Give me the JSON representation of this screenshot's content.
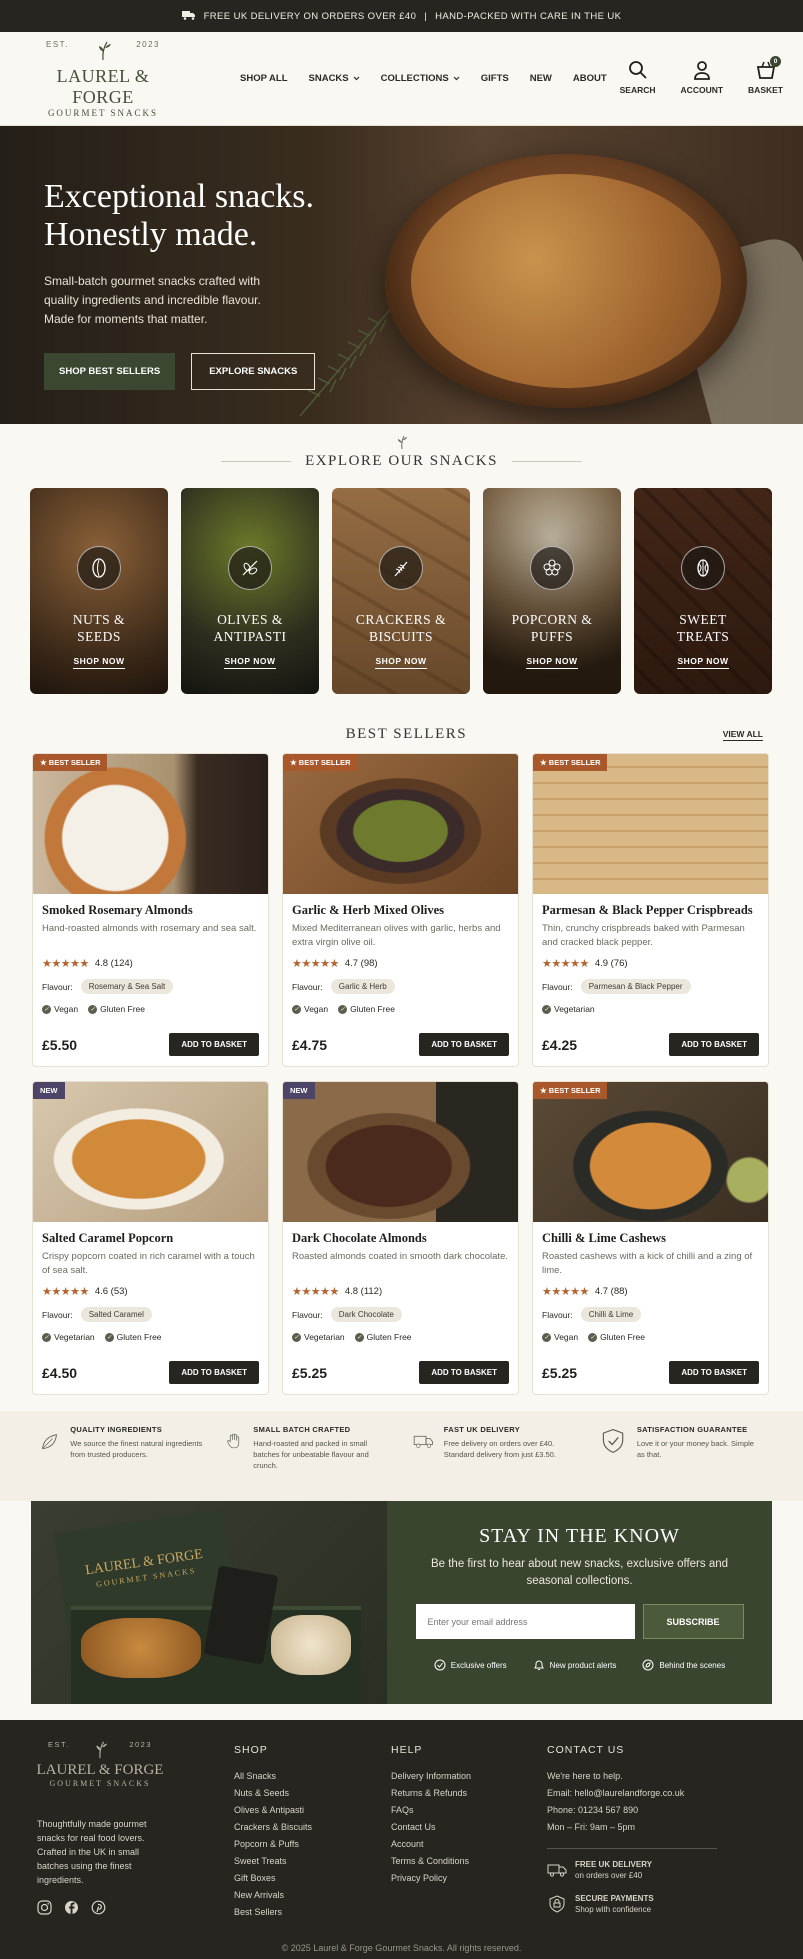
{
  "topbar": {
    "text1": "FREE UK DELIVERY ON ORDERS OVER £40",
    "sep": "|",
    "text2": "HAND-PACKED WITH CARE IN THE UK"
  },
  "logo": {
    "est": "EST.",
    "year": "2023",
    "name": "LAUREL & FORGE",
    "sub": "GOURMET SNACKS"
  },
  "nav": [
    "SHOP ALL",
    "SNACKS",
    "COLLECTIONS",
    "GIFTS",
    "NEW",
    "ABOUT"
  ],
  "header_icons": {
    "search": "SEARCH",
    "account": "ACCOUNT",
    "basket": "BASKET",
    "basket_count": "0"
  },
  "hero": {
    "line1": "Exceptional snacks.",
    "line2": "Honestly made.",
    "desc": "Small-batch gourmet snacks crafted with quality ingredients and incredible flavour. Made for moments that matter.",
    "btn1": "SHOP BEST SELLERS",
    "btn2": "EXPLORE SNACKS"
  },
  "explore": {
    "title": "EXPLORE OUR SNACKS",
    "categories": [
      {
        "l1": "NUTS &",
        "l2": "SEEDS",
        "shop": "SHOP NOW"
      },
      {
        "l1": "OLIVES &",
        "l2": "ANTIPASTI",
        "shop": "SHOP NOW"
      },
      {
        "l1": "CRACKERS &",
        "l2": "BISCUITS",
        "shop": "SHOP NOW"
      },
      {
        "l1": "POPCORN &",
        "l2": "PUFFS",
        "shop": "SHOP NOW"
      },
      {
        "l1": "SWEET",
        "l2": "TREATS",
        "shop": "SHOP NOW"
      }
    ]
  },
  "bestsellers": {
    "title": "BEST SELLERS",
    "view_all": "VIEW ALL",
    "flavour_label": "Flavour:",
    "add_label": "ADD TO BASKET",
    "products": [
      {
        "tag": "★ BEST SELLER",
        "name": "Smoked Rosemary Almonds",
        "desc": "Hand-roasted almonds with rosemary and sea salt.",
        "rating": "4.8 (124)",
        "flavour": "Rosemary & Sea Salt",
        "diet": [
          "Vegan",
          "Gluten Free"
        ],
        "price": "£5.50"
      },
      {
        "tag": "★ BEST SELLER",
        "name": "Garlic & Herb Mixed Olives",
        "desc": "Mixed Mediterranean olives with garlic, herbs and extra virgin olive oil.",
        "rating": "4.7 (98)",
        "flavour": "Garlic & Herb",
        "diet": [
          "Vegan",
          "Gluten Free"
        ],
        "price": "£4.75"
      },
      {
        "tag": "★ BEST SELLER",
        "name": "Parmesan & Black Pepper Crispbreads",
        "desc": "Thin, crunchy crispbreads baked with Parmesan and cracked black pepper.",
        "rating": "4.9 (76)",
        "flavour": "Parmesan & Black Pepper",
        "diet": [
          "Vegetarian"
        ],
        "price": "£4.25"
      },
      {
        "tag": "NEW",
        "name": "Salted Caramel Popcorn",
        "desc": "Crispy popcorn coated in rich caramel with a touch of sea salt.",
        "rating": "4.6 (53)",
        "flavour": "Salted Caramel",
        "diet": [
          "Vegetarian",
          "Gluten Free"
        ],
        "price": "£4.50"
      },
      {
        "tag": "NEW",
        "name": "Dark Chocolate Almonds",
        "desc": "Roasted almonds coated in smooth dark chocolate.",
        "rating": "4.8 (112)",
        "flavour": "Dark Chocolate",
        "diet": [
          "Vegetarian",
          "Gluten Free"
        ],
        "price": "£5.25"
      },
      {
        "tag": "★ BEST SELLER",
        "name": "Chilli & Lime Cashews",
        "desc": "Roasted cashews with a kick of chilli and a zing of lime.",
        "rating": "4.7 (88)",
        "flavour": "Chilli & Lime",
        "diet": [
          "Vegan",
          "Gluten Free"
        ],
        "price": "£5.25"
      }
    ]
  },
  "features": [
    {
      "title": "QUALITY INGREDIENTS",
      "text": "We source the finest natural ingredients from trusted producers."
    },
    {
      "title": "SMALL BATCH CRAFTED",
      "text": "Hand-roasted and packed in small batches for unbeatable flavour and crunch."
    },
    {
      "title": "FAST UK DELIVERY",
      "text": "Free delivery on orders over £40. Standard delivery from just £3.50."
    },
    {
      "title": "SATISFACTION GUARANTEE",
      "text": "Love it or your money back. Simple as that."
    }
  ],
  "newsletter": {
    "title": "STAY IN THE KNOW",
    "desc": "Be the first to hear about new snacks, exclusive offers and seasonal collections.",
    "placeholder": "Enter your email address",
    "button": "SUBSCRIBE",
    "perks": [
      "Exclusive offers",
      "New product alerts",
      "Behind the scenes"
    ],
    "box_brand": "LAUREL & FORGE",
    "box_sub": "GOURMET SNACKS"
  },
  "footer": {
    "about": "Thoughtfully made gourmet snacks for real food lovers. Crafted in the UK in small batches using the finest ingredients.",
    "shop_title": "SHOP",
    "shop": [
      "All Snacks",
      "Nuts & Seeds",
      "Olives & Antipasti",
      "Crackers & Biscuits",
      "Popcorn & Puffs",
      "Sweet Treats",
      "Gift Boxes",
      "New Arrivals",
      "Best Sellers"
    ],
    "help_title": "HELP",
    "help": [
      "Delivery Information",
      "Returns & Refunds",
      "FAQs",
      "Contact Us",
      "Account",
      "Terms & Conditions",
      "Privacy Policy"
    ],
    "contact_title": "CONTACT US",
    "contact": [
      "We're here to help.",
      "Email: hello@laurelandforge.co.uk",
      "Phone: 01234 567 890",
      "Mon – Fri: 9am – 5pm"
    ],
    "delivery_title": "FREE UK DELIVERY",
    "delivery_sub": "on orders over £40",
    "secure_title": "SECURE PAYMENTS",
    "secure_sub": "Shop with confidence",
    "copyright": "© 2025 Laurel & Forge Gourmet Snacks. All rights reserved."
  }
}
